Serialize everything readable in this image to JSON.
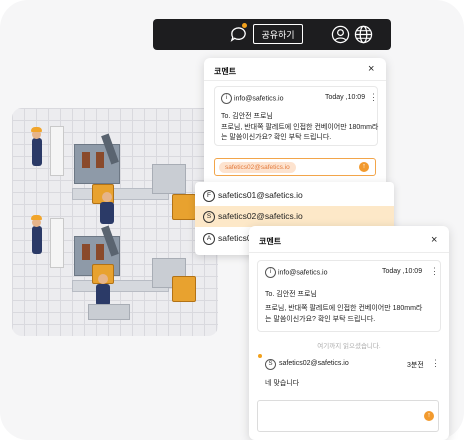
{
  "toolbar": {
    "share_label": "공유하기",
    "icons": [
      "comment-icon",
      "user-icon",
      "globe-icon"
    ]
  },
  "back_panel": {
    "title": "코멘트",
    "close": "×",
    "comment": {
      "author": "info@safetics.io",
      "time": "Today ,10:09",
      "to_line": "To. 김안전 프로님",
      "body_line1": "프로님, 반대쪽 팔레트에 인접한 컨베이어만 180mm라",
      "body_line2": "는 말씀이신가요? 확인 부탁 드립니다."
    },
    "mention_chip": "safetics02@safetics.io"
  },
  "mention_dropdown": {
    "items": [
      {
        "letter": "F",
        "email": "safetics01@safetics.io"
      },
      {
        "letter": "S",
        "email": "safetics02@safetics.io"
      },
      {
        "letter": "A",
        "email": "safetics03@safetics.io"
      }
    ],
    "active_index": 1
  },
  "front_panel": {
    "title": "코멘트",
    "close": "×",
    "comment": {
      "author": "info@safetics.io",
      "time": "Today ,10:09",
      "to_line": "To. 김안전 프로님",
      "body_line1": "프로님, 반대쪽 팔레트에 인접한 컨베이어만 180mm라",
      "body_line2": "는 말씀이신가요? 확인 부탁 드립니다."
    },
    "read_marker": "여기까지 읽으셨습니다.",
    "reply": {
      "author_letter": "S",
      "author": "safetics02@safetics.io",
      "time": "3분전",
      "body": "네 맞습니다"
    },
    "input_placeholder": ""
  },
  "colors": {
    "accent": "#f29a2e",
    "toolbar_bg": "#1d1d1f",
    "dropdown_active": "#fde8c8"
  }
}
